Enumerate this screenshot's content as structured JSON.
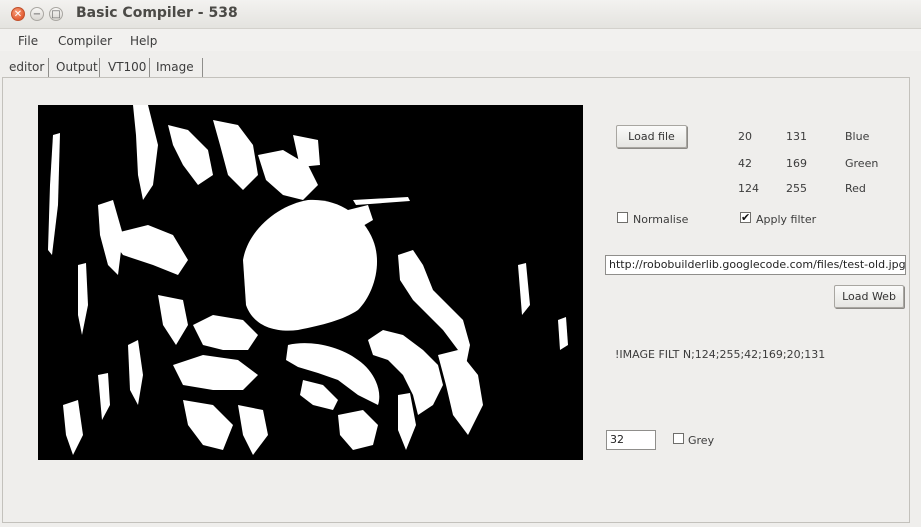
{
  "window": {
    "title": "Basic Compiler - 538",
    "close_glyph": "✕",
    "min_glyph": "−",
    "max_glyph": "□"
  },
  "menu": [
    "File",
    "Compiler",
    "Help"
  ],
  "tabs": [
    "editor",
    "Output",
    "VT100",
    "Image"
  ],
  "image_tab": {
    "load_file_label": "Load file",
    "channels": [
      {
        "min": "20",
        "max": "131",
        "name": "Blue"
      },
      {
        "min": "42",
        "max": "169",
        "name": "Green"
      },
      {
        "min": "124",
        "max": "255",
        "name": "Red"
      }
    ],
    "normalise": {
      "label": "Normalise",
      "checked": false
    },
    "apply_filter": {
      "label": "Apply filter",
      "checked": true,
      "mark": "✔"
    },
    "url_value": "http://robobuilderlib.googlecode.com/files/test-old.jpg",
    "load_web_label": "Load Web",
    "command_text": "!IMAGE FILT N;124;255;42;169;20;131",
    "threshold_value": "32",
    "grey": {
      "label": "Grey",
      "checked": false
    }
  },
  "colors": {
    "image_background": "#000000",
    "image_foreground": "#ffffff"
  }
}
